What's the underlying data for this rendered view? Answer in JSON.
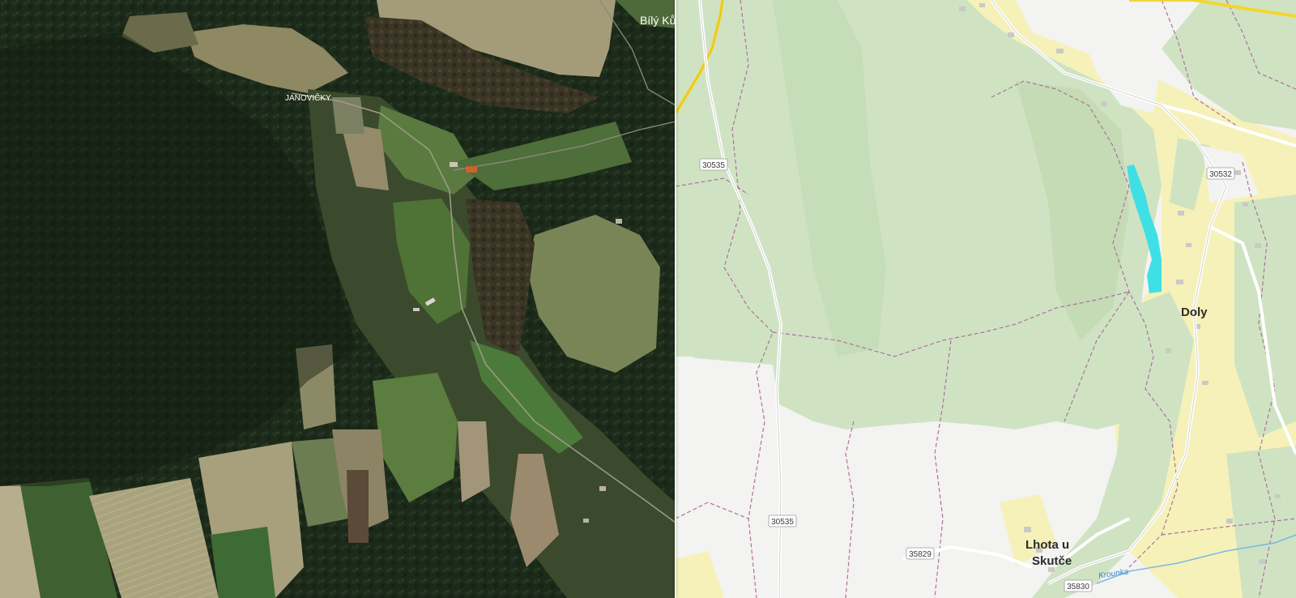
{
  "left_view": {
    "type": "satellite",
    "places": [
      {
        "name": "JANOVIČKY"
      },
      {
        "name": "Bílý Ků"
      }
    ]
  },
  "right_view": {
    "type": "map",
    "places": [
      {
        "name": "Doly"
      },
      {
        "name": "Lhota u"
      },
      {
        "name": "Skutče"
      }
    ],
    "road_numbers": [
      "30535",
      "30532",
      "30535",
      "35829",
      "35830"
    ],
    "water_label": "Krounka",
    "colors": {
      "forest": "#cfe3c3",
      "forest_dark": "#bcd7ad",
      "field": "#f4f4f2",
      "settlement": "#f6f1b8",
      "road_major": "#f4d531",
      "road_minor": "#ffffff",
      "boundary": "#b0709a",
      "water_highlight": "#3fdfe6"
    }
  }
}
